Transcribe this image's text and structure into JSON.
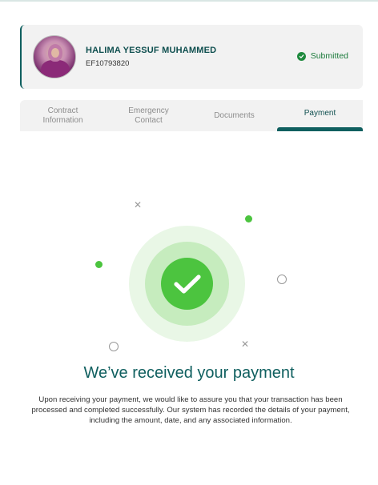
{
  "profile": {
    "name": "HALIMA YESSUF MUHAMMED",
    "code": "EF10793820",
    "status": "Submitted",
    "status_color": "#1f8a3e"
  },
  "tabs": [
    {
      "label": "Contract Information",
      "active": false
    },
    {
      "label": "Emergency Contact",
      "active": false
    },
    {
      "label": "Documents",
      "active": false
    },
    {
      "label": "Payment",
      "active": true
    }
  ],
  "confirmation": {
    "headline": "We’ve received your payment",
    "body": "Upon receiving your payment, we would like to assure you that your transaction has been processed and completed successfully. Our system has recorded the details of your payment, including the amount, date, and any associated information."
  },
  "colors": {
    "accent": "#0f5f5f",
    "success": "#4cc43f"
  },
  "icons": {
    "status": "check-circle-icon",
    "confirmation": "checkmark-icon"
  }
}
